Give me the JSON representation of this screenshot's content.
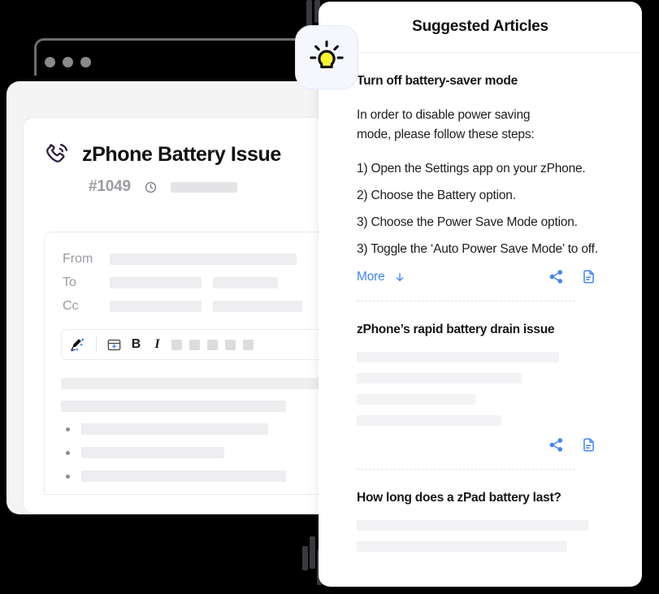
{
  "background": {
    "color": "#000000"
  },
  "browser_window": {
    "dots_count": 3,
    "dot_color": "#8a8a8a"
  },
  "ticket": {
    "icon": "phone-call-icon",
    "title": "zPhone Battery Issue",
    "id": "#1049",
    "time_icon": "clock-icon",
    "compose": {
      "fields": [
        {
          "label": "From",
          "skeletons": [
            230
          ]
        },
        {
          "label": "To",
          "skeletons": [
            113,
            80
          ]
        },
        {
          "label": "Cc",
          "skeletons": [
            113,
            110
          ]
        }
      ],
      "toolbar": {
        "ai_icon": "magic-pen-icon",
        "insert_icon": "insert-row-icon",
        "bold_label": "B",
        "italic_label": "I",
        "blank_buttons": 5
      },
      "body_lines": [
        330,
        277
      ],
      "bullets": [
        230,
        176,
        252
      ]
    }
  },
  "badge": {
    "icon": "lightbulb-icon",
    "bulb_color": "#f9f535",
    "background": "#f5f7fd"
  },
  "articles_panel": {
    "header": {
      "title": "Suggested Articles"
    },
    "articles": [
      {
        "title": "Turn off battery-saver mode",
        "paragraph": "In order to disable power saving mode, please follow these steps:",
        "steps": [
          "1) Open the Settings app on your zPhone.",
          "2) Choose the Battery option.",
          "3) Choose the Power Save Mode option.",
          "3) Toggle the ‘Auto Power Save Mode’ to off."
        ],
        "more_label": "More",
        "more_icon": "arrow-down-icon",
        "share_icon": "share-icon",
        "doc_icon": "document-icon",
        "skeletons": []
      },
      {
        "title": "zPhone’s rapid battery drain issue",
        "paragraph": "",
        "steps": [],
        "share_icon": "share-icon",
        "doc_icon": "document-icon",
        "skeletons": [
          249,
          203,
          146,
          178
        ]
      },
      {
        "title": "How long does a zPad battery last?",
        "paragraph": "",
        "steps": [],
        "skeletons": [
          285,
          259
        ]
      }
    ],
    "accent_color": "#4285f4"
  }
}
